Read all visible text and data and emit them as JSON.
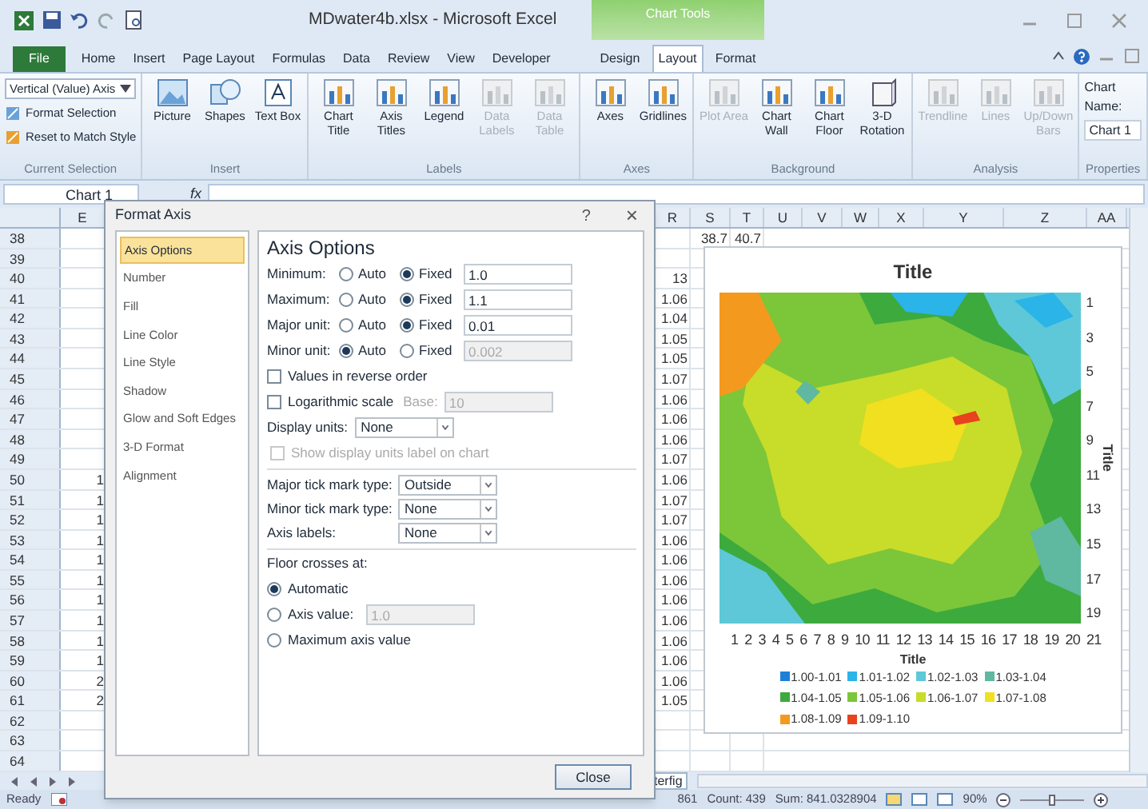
{
  "title_bar": {
    "title": "MDwater4b.xlsx - Microsoft Excel",
    "context_group": "Chart Tools"
  },
  "tabs": [
    {
      "label": "File",
      "kind": "file",
      "selected": false
    },
    {
      "label": "Home",
      "kind": "main",
      "selected": false
    },
    {
      "label": "Insert",
      "kind": "main",
      "selected": false
    },
    {
      "label": "Page Layout",
      "kind": "main",
      "selected": false
    },
    {
      "label": "Formulas",
      "kind": "main",
      "selected": false
    },
    {
      "label": "Data",
      "kind": "main",
      "selected": false
    },
    {
      "label": "Review",
      "kind": "main",
      "selected": false
    },
    {
      "label": "View",
      "kind": "main",
      "selected": false
    },
    {
      "label": "Developer",
      "kind": "main",
      "selected": false
    },
    {
      "label": "Design",
      "kind": "context",
      "selected": false
    },
    {
      "label": "Layout",
      "kind": "context",
      "selected": true
    },
    {
      "label": "Format",
      "kind": "context",
      "selected": false
    }
  ],
  "ribbon": {
    "current_selection": {
      "dropdown": "Vertical (Value) Axis",
      "buttons": [
        "Format Selection",
        "Reset to Match Style"
      ],
      "label": "Current Selection"
    },
    "groups": [
      {
        "label": "Insert",
        "buttons": [
          {
            "label": "Picture",
            "disabled": false
          },
          {
            "label": "Shapes",
            "disabled": false
          },
          {
            "label": "Text Box",
            "disabled": false
          }
        ]
      },
      {
        "label": "Labels",
        "buttons": [
          {
            "label": "Chart Title",
            "disabled": false
          },
          {
            "label": "Axis Titles",
            "disabled": false
          },
          {
            "label": "Legend",
            "disabled": false
          },
          {
            "label": "Data Labels",
            "disabled": true
          },
          {
            "label": "Data Table",
            "disabled": true
          }
        ]
      },
      {
        "label": "Axes",
        "buttons": [
          {
            "label": "Axes",
            "disabled": false
          },
          {
            "label": "Gridlines",
            "disabled": false
          }
        ]
      },
      {
        "label": "Background",
        "buttons": [
          {
            "label": "Plot Area",
            "disabled": true
          },
          {
            "label": "Chart Wall",
            "disabled": false
          },
          {
            "label": "Chart Floor",
            "disabled": false
          },
          {
            "label": "3-D Rotation",
            "disabled": false
          }
        ]
      },
      {
        "label": "Analysis",
        "buttons": [
          {
            "label": "Trendline",
            "disabled": true
          },
          {
            "label": "Lines",
            "disabled": true
          },
          {
            "label": "Up/Down Bars",
            "disabled": true
          }
        ]
      }
    ],
    "properties": {
      "label": "Properties",
      "name_label": "Chart Name:",
      "name_value": "Chart 1"
    }
  },
  "formula_bar": {
    "name_box": "Chart 1",
    "function_label": "fx"
  },
  "sheet": {
    "columns_left": [
      "E"
    ],
    "columns_right": [
      "R",
      "S",
      "T",
      "U",
      "V",
      "W",
      "X",
      "Y",
      "Z",
      "AA"
    ],
    "rows": [
      {
        "header": "38",
        "s": "38.7",
        "t": "40.7"
      },
      {
        "header": "39"
      },
      {
        "header": "40",
        "r": "13"
      },
      {
        "header": "41",
        "r": "1.06"
      },
      {
        "header": "42",
        "r": "1.04"
      },
      {
        "header": "43",
        "r": "1.05"
      },
      {
        "header": "44",
        "r": "1.05"
      },
      {
        "header": "45",
        "r": "1.07"
      },
      {
        "header": "46",
        "r": "1.06"
      },
      {
        "header": "47",
        "r": "1.06"
      },
      {
        "header": "48",
        "r": "1.06"
      },
      {
        "header": "49",
        "r": "1.07"
      },
      {
        "header": "50",
        "e": "1",
        "r": "1.06"
      },
      {
        "header": "51",
        "e": "1",
        "r": "1.07"
      },
      {
        "header": "52",
        "e": "1",
        "r": "1.07"
      },
      {
        "header": "53",
        "e": "1",
        "r": "1.06"
      },
      {
        "header": "54",
        "e": "1",
        "r": "1.06"
      },
      {
        "header": "55",
        "e": "1",
        "r": "1.06"
      },
      {
        "header": "56",
        "e": "1",
        "r": "1.06"
      },
      {
        "header": "57",
        "e": "1",
        "r": "1.06"
      },
      {
        "header": "58",
        "e": "1",
        "r": "1.06"
      },
      {
        "header": "59",
        "e": "1",
        "r": "1.06"
      },
      {
        "header": "60",
        "e": "2",
        "r": "1.06"
      },
      {
        "header": "61",
        "e": "2",
        "r": "1.05"
      },
      {
        "header": "62"
      },
      {
        "header": "63"
      },
      {
        "header": "64"
      }
    ],
    "sheet_tab": "terfig"
  },
  "chart": {
    "title": "Title",
    "x_ticks": [
      "1",
      "2",
      "3",
      "4",
      "5",
      "6",
      "7",
      "8",
      "9",
      "10",
      "11",
      "12",
      "13",
      "14",
      "15",
      "16",
      "17",
      "18",
      "19",
      "20",
      "21"
    ],
    "y_ticks": [
      "1",
      "3",
      "5",
      "7",
      "9",
      "11",
      "13",
      "15",
      "17",
      "19"
    ],
    "x_title": "Title",
    "y_title": "Title",
    "legend": [
      {
        "label": "1.00-1.01",
        "color": "#1e7fd8"
      },
      {
        "label": "1.01-1.02",
        "color": "#2ab4e8"
      },
      {
        "label": "1.02-1.03",
        "color": "#5ec8d8"
      },
      {
        "label": "1.03-1.04",
        "color": "#5fb8a0"
      },
      {
        "label": "1.04-1.05",
        "color": "#3daa3d"
      },
      {
        "label": "1.05-1.06",
        "color": "#7cc63a"
      },
      {
        "label": "1.06-1.07",
        "color": "#c8dc2a"
      },
      {
        "label": "1.07-1.08",
        "color": "#f0e020"
      },
      {
        "label": "1.08-1.09",
        "color": "#f39a1e"
      },
      {
        "label": "1.09-1.10",
        "color": "#e8421e"
      }
    ]
  },
  "dialog": {
    "title": "Format Axis",
    "help": "?",
    "close_glyph": "×",
    "categories": [
      {
        "label": "Axis Options",
        "selected": true
      },
      {
        "label": "Number",
        "selected": false
      },
      {
        "label": "Fill",
        "selected": false
      },
      {
        "label": "Line Color",
        "selected": false
      },
      {
        "label": "Line Style",
        "selected": false
      },
      {
        "label": "Shadow",
        "selected": false
      },
      {
        "label": "Glow and Soft Edges",
        "selected": false
      },
      {
        "label": "3-D Format",
        "selected": false
      },
      {
        "label": "Alignment",
        "selected": false
      }
    ],
    "heading": "Axis Options",
    "bounds": [
      {
        "label": "Minimum:",
        "options": [
          {
            "label": "Auto",
            "selected": false
          },
          {
            "label": "Fixed",
            "selected": true
          }
        ],
        "value": "1.0",
        "disabled": false
      },
      {
        "label": "Maximum:",
        "options": [
          {
            "label": "Auto",
            "selected": false
          },
          {
            "label": "Fixed",
            "selected": true
          }
        ],
        "value": "1.1",
        "disabled": false
      },
      {
        "label": "Major unit:",
        "options": [
          {
            "label": "Auto",
            "selected": false
          },
          {
            "label": "Fixed",
            "selected": true
          }
        ],
        "value": "0.01",
        "disabled": false
      },
      {
        "label": "Minor unit:",
        "options": [
          {
            "label": "Auto",
            "selected": true
          },
          {
            "label": "Fixed",
            "selected": false
          }
        ],
        "value": "0.002",
        "disabled": true
      }
    ],
    "reverse": {
      "label": "Values in reverse order",
      "checked": false
    },
    "log": {
      "label": "Logarithmic scale",
      "checked": false,
      "base_label": "Base:",
      "base_value": "10",
      "disabled": true
    },
    "display_units": {
      "label": "Display units:",
      "value": "None"
    },
    "show_units": {
      "label": "Show display units label on chart",
      "checked": false,
      "disabled": true
    },
    "tick_settings": [
      {
        "label": "Major tick mark type:",
        "value": "Outside"
      },
      {
        "label": "Minor tick mark type:",
        "value": "None"
      },
      {
        "label": "Axis labels:",
        "value": "None"
      }
    ],
    "floor_label": "Floor crosses at:",
    "floor_options": [
      {
        "label": "Automatic",
        "selected": true,
        "kind": "plain"
      },
      {
        "label": "Axis value:",
        "selected": false,
        "kind": "value",
        "value": "1.0",
        "disabled": true
      },
      {
        "label": "Maximum axis value",
        "selected": false,
        "kind": "plain"
      }
    ],
    "close_button": "Close"
  },
  "status_bar": {
    "ready": "Ready",
    "average_tail": "861",
    "count": "Count: 439",
    "sum": "Sum: 841.0328904",
    "zoom": "90%",
    "zoom_slider": {
      "level": 0.5
    }
  }
}
